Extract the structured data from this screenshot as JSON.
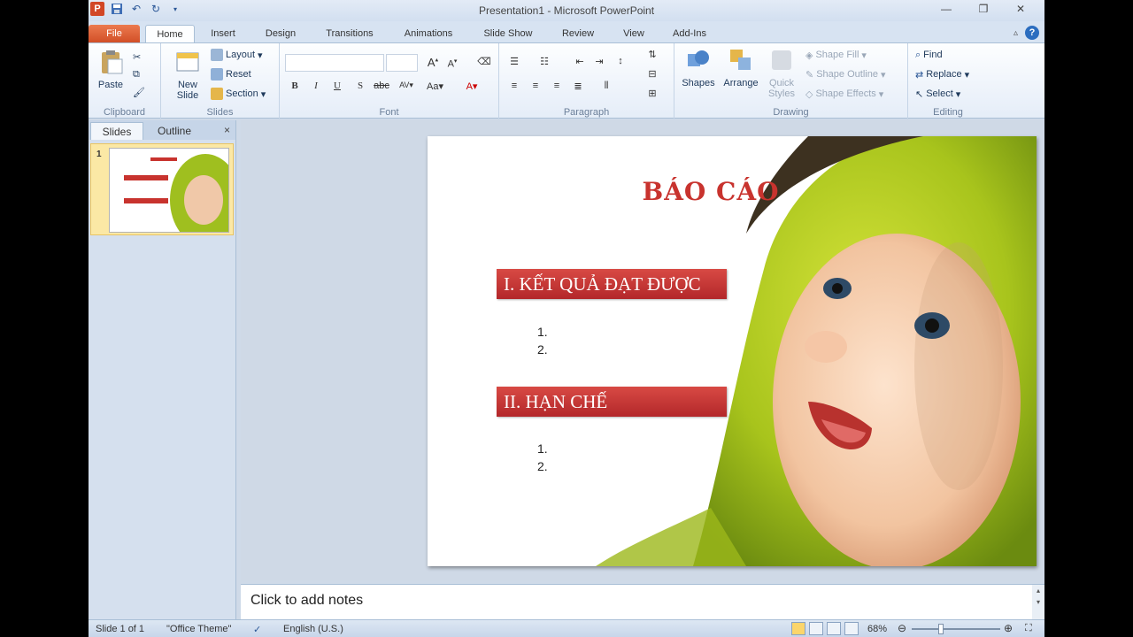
{
  "window": {
    "title": "Presentation1 - Microsoft PowerPoint",
    "app_icon": "P"
  },
  "quick_access": [
    "save-icon",
    "undo-icon",
    "redo-icon",
    "customize-icon"
  ],
  "tabs": [
    {
      "label": "File"
    },
    {
      "label": "Home",
      "active": true
    },
    {
      "label": "Insert"
    },
    {
      "label": "Design"
    },
    {
      "label": "Transitions"
    },
    {
      "label": "Animations"
    },
    {
      "label": "Slide Show"
    },
    {
      "label": "Review"
    },
    {
      "label": "View"
    },
    {
      "label": "Add-Ins"
    }
  ],
  "ribbon": {
    "clipboard": {
      "label": "Clipboard",
      "paste": "Paste"
    },
    "slides": {
      "label": "Slides",
      "new_slide": "New Slide",
      "layout": "Layout",
      "reset": "Reset",
      "section": "Section"
    },
    "font": {
      "label": "Font"
    },
    "paragraph": {
      "label": "Paragraph"
    },
    "drawing": {
      "label": "Drawing",
      "shapes": "Shapes",
      "arrange": "Arrange",
      "quick_styles": "Quick Styles",
      "shape_fill": "Shape Fill",
      "shape_outline": "Shape Outline",
      "shape_effects": "Shape Effects"
    },
    "editing": {
      "label": "Editing",
      "find": "Find",
      "replace": "Replace",
      "select": "Select"
    }
  },
  "left_pane": {
    "tabs": [
      "Slides",
      "Outline"
    ],
    "close": "×",
    "thumb_number": "1"
  },
  "slide": {
    "title": "BÁO CÁO",
    "sections": [
      {
        "heading": "I. KẾT QUẢ ĐẠT ĐƯỢC",
        "items": [
          "1.",
          "2."
        ]
      },
      {
        "heading": "II. HẠN CHẾ",
        "items": [
          "1.",
          "2."
        ]
      }
    ]
  },
  "notes": {
    "placeholder": "Click to add notes"
  },
  "statusbar": {
    "slide_info": "Slide 1 of 1",
    "theme": "\"Office Theme\"",
    "language": "English (U.S.)",
    "zoom": "68%"
  },
  "colors": {
    "accent_red": "#c8332e",
    "file_tab": "#d24f27"
  }
}
